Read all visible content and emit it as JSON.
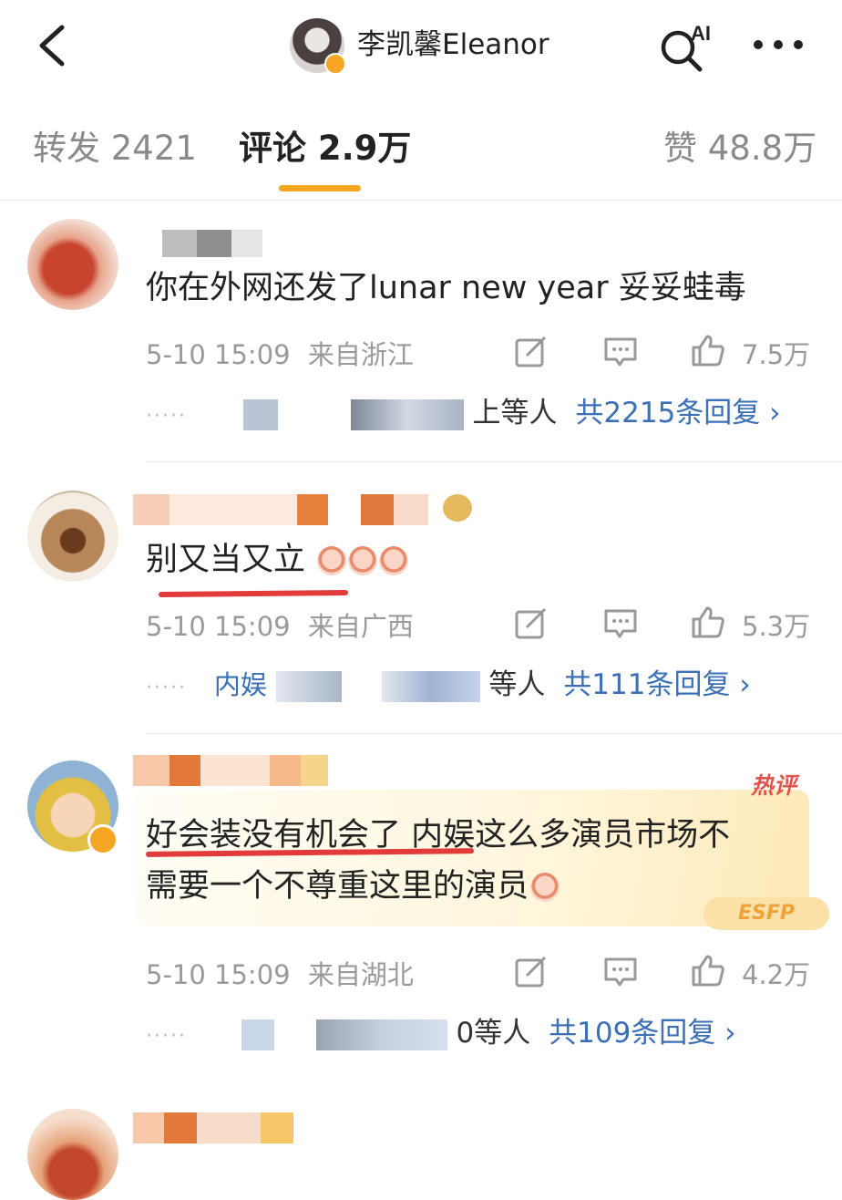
{
  "header": {
    "title": "李凯馨Eleanor",
    "ai_label": "AI"
  },
  "tabs": [
    {
      "label": "转发 2421"
    },
    {
      "label": "评论 2.9万"
    },
    {
      "label": "赞 48.8万"
    }
  ],
  "colors": {
    "accent": "#f5a623",
    "link": "#3b6fb6",
    "underline": "#e33a3a"
  },
  "comments": [
    {
      "text": "你在外网还发了lunar new year 妥妥蛙毒",
      "time": "5-10 15:09",
      "location": "来自浙江",
      "likes": "7.5万",
      "reply_by_suffix": "上等人",
      "reply_count": "共2215条回复"
    },
    {
      "text": "别又当又立",
      "time": "5-10 15:09",
      "location": "来自广西",
      "likes": "5.3万",
      "reply_by_prefix": "内娱",
      "reply_by_suffix": "等人",
      "reply_count": "共111条回复"
    },
    {
      "text": "好会装没有机会了 内娱这么多演员市场不需要一个不尊重这里的演员",
      "line1": "好会装没有机会了 内娱这么多演员市场不",
      "line2": "需要一个不尊重这里的演员",
      "hot_tag": "热评",
      "badge_text": "ESFP",
      "time": "5-10 15:09",
      "location": "来自湖北",
      "likes": "4.2万",
      "reply_by_suffix": "0等人",
      "reply_count": "共109条回复"
    }
  ]
}
